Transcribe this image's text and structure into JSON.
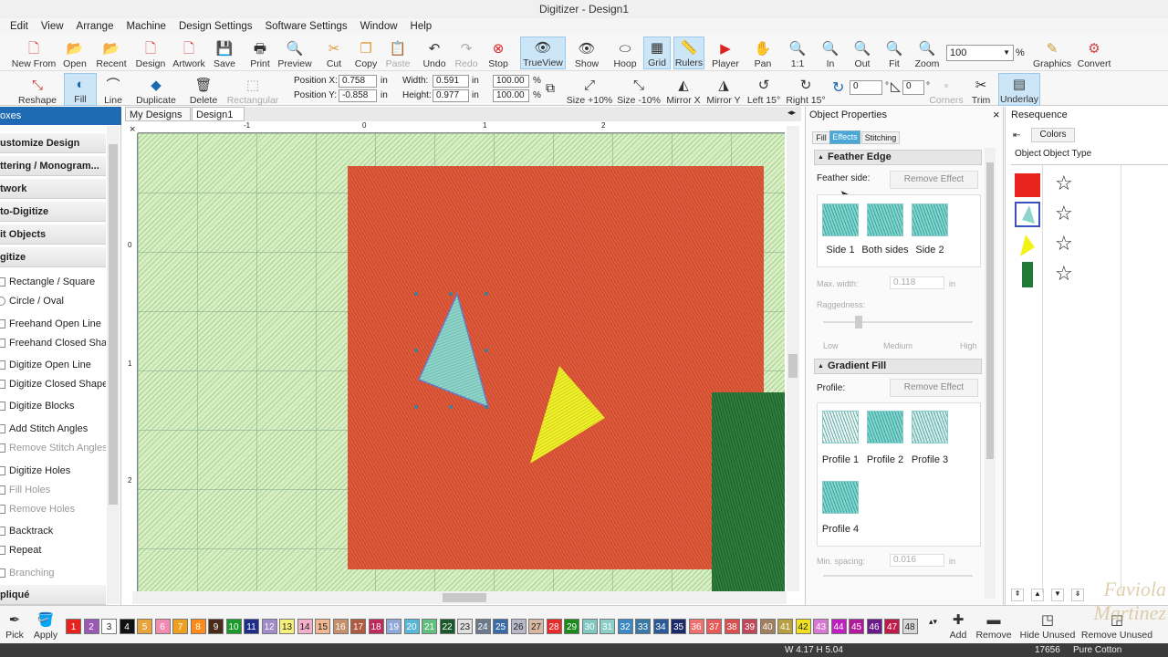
{
  "window": {
    "title": "Digitizer - Design1"
  },
  "menu": [
    "Edit",
    "View",
    "Arrange",
    "Machine",
    "Design Settings",
    "Software Settings",
    "Window",
    "Help"
  ],
  "toolbar1": [
    {
      "label": "New From",
      "icon": "new-from-icon"
    },
    {
      "label": "Open",
      "icon": "open-icon"
    },
    {
      "label": "Recent",
      "icon": "recent-icon"
    },
    {
      "label": "Design",
      "icon": "design-icon"
    },
    {
      "label": "Artwork",
      "icon": "artwork-icon"
    },
    {
      "label": "Save",
      "icon": "save-icon"
    },
    {
      "label": "Print",
      "icon": "print-icon"
    },
    {
      "label": "Preview",
      "icon": "preview-icon"
    },
    {
      "label": "Cut",
      "icon": "cut-icon"
    },
    {
      "label": "Copy",
      "icon": "copy-icon"
    },
    {
      "label": "Paste",
      "icon": "paste-icon"
    },
    {
      "label": "Undo",
      "icon": "undo-icon"
    },
    {
      "label": "Redo",
      "icon": "redo-icon"
    },
    {
      "label": "Stop",
      "icon": "stop-icon"
    },
    {
      "label": "TrueView",
      "icon": "trueview-icon"
    },
    {
      "label": "Show",
      "icon": "show-icon"
    },
    {
      "label": "Hoop",
      "icon": "hoop-icon"
    },
    {
      "label": "Grid",
      "icon": "grid-icon"
    },
    {
      "label": "Rulers",
      "icon": "rulers-icon"
    },
    {
      "label": "Player",
      "icon": "player-icon"
    },
    {
      "label": "Pan",
      "icon": "pan-icon"
    },
    {
      "label": "1:1",
      "icon": "zoom-one-icon"
    },
    {
      "label": "In",
      "icon": "zoom-in-icon"
    },
    {
      "label": "Out",
      "icon": "zoom-out-icon"
    },
    {
      "label": "Fit",
      "icon": "zoom-fit-icon"
    },
    {
      "label": "Zoom",
      "icon": "zoom-icon"
    },
    {
      "label": "Graphics",
      "icon": "graphics-icon"
    },
    {
      "label": "Convert",
      "icon": "convert-icon"
    }
  ],
  "zoom": {
    "value": "100",
    "unit": "%"
  },
  "toolbar2": [
    {
      "label": "Reshape"
    },
    {
      "label": "Fill"
    },
    {
      "label": "Line"
    },
    {
      "label": "Duplicate"
    },
    {
      "label": "Delete"
    },
    {
      "label": "Rectangular"
    },
    {
      "label": "Size +10%"
    },
    {
      "label": "Size -10%"
    },
    {
      "label": "Mirror X"
    },
    {
      "label": "Mirror Y"
    },
    {
      "label": "Left 15°"
    },
    {
      "label": "Right 15°"
    },
    {
      "label": "Corners"
    },
    {
      "label": "Trim"
    },
    {
      "label": "Underlay"
    }
  ],
  "position": {
    "x_label": "Position X:",
    "x": "0.758",
    "y_label": "Position Y:",
    "y": "-0.858",
    "unit": "in"
  },
  "size": {
    "w_label": "Width:",
    "w": "0.591",
    "h_label": "Height:",
    "h": "0.977",
    "unit": "in",
    "wp": "100.00",
    "hp": "100.00",
    "pct": "%"
  },
  "rotate": {
    "value1": "0",
    "value2": "0",
    "deg": "°"
  },
  "left_panel": {
    "header": "oxes",
    "sections": [
      {
        "title": "ustomize Design"
      },
      {
        "title": "ttering / Monogram..."
      },
      {
        "title": "twork"
      },
      {
        "title": "to-Digitize"
      },
      {
        "title": "it Objects"
      },
      {
        "title": "gitize"
      }
    ],
    "items": [
      {
        "label": "Rectangle / Square",
        "disabled": false
      },
      {
        "label": "Circle / Oval",
        "disabled": false
      },
      {
        "label": "Freehand Open Line",
        "disabled": false
      },
      {
        "label": "Freehand Closed Sha...",
        "disabled": false
      },
      {
        "label": "Digitize Open Line",
        "disabled": false
      },
      {
        "label": "Digitize Closed Shape",
        "disabled": false
      },
      {
        "label": "Digitize Blocks",
        "disabled": false
      },
      {
        "label": "Add Stitch Angles",
        "disabled": false
      },
      {
        "label": "Remove Stitch Angles",
        "disabled": true
      },
      {
        "label": "Digitize Holes",
        "disabled": false
      },
      {
        "label": "Fill Holes",
        "disabled": true
      },
      {
        "label": "Remove Holes",
        "disabled": true
      },
      {
        "label": "Backtrack",
        "disabled": false
      },
      {
        "label": "Repeat",
        "disabled": false
      },
      {
        "label": "Branching",
        "disabled": true
      }
    ],
    "footer": "pliqué"
  },
  "tabs": [
    {
      "label": "My Designs",
      "close": "×"
    },
    {
      "label": "Design1",
      "close": "×"
    }
  ],
  "ruler": {
    "top": [
      "-1",
      "0",
      "1",
      "2"
    ],
    "left": [
      "0",
      "1",
      "2"
    ]
  },
  "object_properties": {
    "title": "Object Properties",
    "close": "×",
    "tabs": [
      "Fill",
      "Effects",
      "Stitching"
    ],
    "feather": {
      "title": "Feather Edge",
      "side_label": "Feather side:",
      "remove": "Remove Effect",
      "options": [
        "Side 1",
        "Both sides",
        "Side 2"
      ],
      "max_width_label": "Max. width:",
      "max_width": "0.118",
      "max_width_unit": "in",
      "raggedness_label": "Raggedness:",
      "scale": [
        "Low",
        "Medium",
        "High"
      ]
    },
    "gradient": {
      "title": "Gradient Fill",
      "profile_label": "Profile:",
      "remove": "Remove Effect",
      "profiles": [
        "Profile 1",
        "Profile 2",
        "Profile 3",
        "Profile 4"
      ],
      "min_spacing_label": "Min. spacing:",
      "min_spacing": "0.016",
      "unit": "in"
    }
  },
  "resequence": {
    "title": "Resequence",
    "colors_btn": "Colors",
    "col_object": "Object",
    "col_type": "Object Type",
    "rows": [
      {
        "color": "#e8231e",
        "type": "☆"
      },
      {
        "color": "#8fd4cc",
        "type": "☆"
      },
      {
        "color": "#f2f21a",
        "type": "☆"
      },
      {
        "color": "#1e7a35",
        "type": "☆"
      }
    ]
  },
  "palette": {
    "pick": "Pick",
    "apply": "Apply",
    "colors": [
      {
        "n": "1",
        "c": "#e8231e"
      },
      {
        "n": "2",
        "c": "#9b59b6"
      },
      {
        "n": "3",
        "c": "#ffffff"
      },
      {
        "n": "4",
        "c": "#111111"
      },
      {
        "n": "5",
        "c": "#e8a33a"
      },
      {
        "n": "6",
        "c": "#f28ab2"
      },
      {
        "n": "7",
        "c": "#f0a020"
      },
      {
        "n": "8",
        "c": "#ff8c1a"
      },
      {
        "n": "9",
        "c": "#4a2a1a"
      },
      {
        "n": "10",
        "c": "#1a9a2a"
      },
      {
        "n": "11",
        "c": "#1c2e8a"
      },
      {
        "n": "12",
        "c": "#a08cc8"
      },
      {
        "n": "13",
        "c": "#f7f07a"
      },
      {
        "n": "14",
        "c": "#f2b0c8"
      },
      {
        "n": "15",
        "c": "#f0b890"
      },
      {
        "n": "16",
        "c": "#c8906a"
      },
      {
        "n": "17",
        "c": "#b05a40"
      },
      {
        "n": "18",
        "c": "#c02a5a"
      },
      {
        "n": "19",
        "c": "#90a8d8"
      },
      {
        "n": "20",
        "c": "#58b8d8"
      },
      {
        "n": "21",
        "c": "#60c080"
      },
      {
        "n": "22",
        "c": "#1a5a2a"
      },
      {
        "n": "23",
        "c": "#e0e0e0"
      },
      {
        "n": "24",
        "c": "#6a7a8a"
      },
      {
        "n": "25",
        "c": "#3a6aa8"
      },
      {
        "n": "26",
        "c": "#b8b8c8"
      },
      {
        "n": "27",
        "c": "#d8b8a0"
      },
      {
        "n": "28",
        "c": "#e82a2a"
      },
      {
        "n": "29",
        "c": "#1a8a1a"
      },
      {
        "n": "30",
        "c": "#80c8c0"
      },
      {
        "n": "31",
        "c": "#8ad0c8"
      },
      {
        "n": "32",
        "c": "#3a88c8"
      },
      {
        "n": "33",
        "c": "#3a78a8"
      },
      {
        "n": "34",
        "c": "#2a5a9a"
      },
      {
        "n": "35",
        "c": "#1a2a6a"
      },
      {
        "n": "36",
        "c": "#f07070"
      },
      {
        "n": "37",
        "c": "#e85a5a"
      },
      {
        "n": "38",
        "c": "#d85050"
      },
      {
        "n": "39",
        "c": "#c0485a"
      },
      {
        "n": "40",
        "c": "#a08060"
      },
      {
        "n": "41",
        "c": "#b8a040"
      },
      {
        "n": "42",
        "c": "#f0e020"
      },
      {
        "n": "43",
        "c": "#d878d0"
      },
      {
        "n": "44",
        "c": "#c020c0"
      },
      {
        "n": "45",
        "c": "#b01a9a"
      },
      {
        "n": "46",
        "c": "#6a1a8a"
      },
      {
        "n": "47",
        "c": "#c01a4a"
      },
      {
        "n": "48",
        "c": "#d8d8d8"
      }
    ],
    "add": "Add",
    "remove": "Remove",
    "hide_unused": "Hide Unused",
    "remove_unused": "Remove Unused"
  },
  "status": {
    "size": "W 4.17  H 5.04",
    "stitches": "17656",
    "fabric": "Pure Cotton"
  },
  "watermark": "Faviola Martinez"
}
